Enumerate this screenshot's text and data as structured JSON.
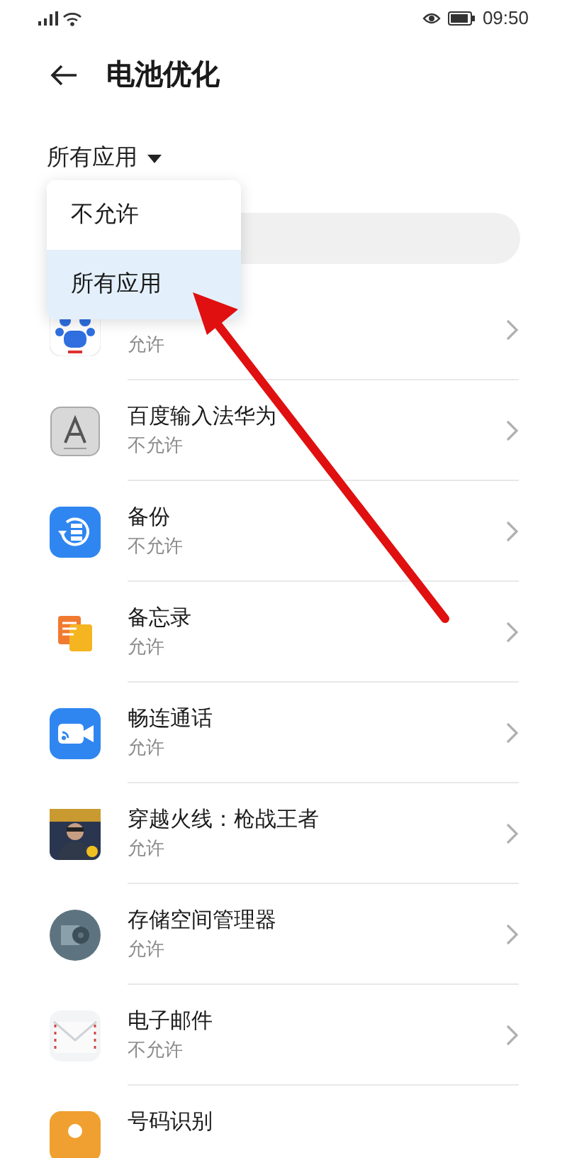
{
  "status_bar": {
    "time": "09:50"
  },
  "header": {
    "title": "电池优化"
  },
  "filter": {
    "label": "所有应用"
  },
  "dropdown": {
    "options": [
      {
        "label": "不允许",
        "selected": false
      },
      {
        "label": "所有应用",
        "selected": true
      }
    ]
  },
  "apps": [
    {
      "status": "允许"
    },
    {
      "name": "百度输入法华为",
      "status": "不允许"
    },
    {
      "name": "备份",
      "status": "不允许"
    },
    {
      "name": "备忘录",
      "status": "允许"
    },
    {
      "name": "畅连通话",
      "status": "允许"
    },
    {
      "name": "穿越火线：枪战王者",
      "status": "允许"
    },
    {
      "name": "存储空间管理器",
      "status": "允许"
    },
    {
      "name": "电子邮件",
      "status": "不允许"
    },
    {
      "name": "号码识别"
    }
  ]
}
